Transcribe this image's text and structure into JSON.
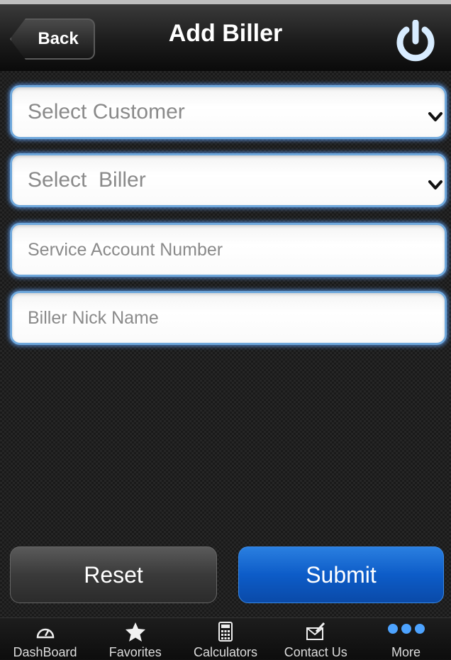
{
  "header": {
    "back_label": "Back",
    "title": "Add Biller",
    "power_icon": "power-icon"
  },
  "form": {
    "customer_select": {
      "value": "Select Customer"
    },
    "biller_select": {
      "value": "Select  Biller"
    },
    "service_account": {
      "placeholder": "Service Account Number"
    },
    "nick_name": {
      "placeholder": "Biller Nick Name"
    }
  },
  "actions": {
    "reset_label": "Reset",
    "submit_label": "Submit"
  },
  "tabbar": {
    "items": [
      {
        "label": "DashBoard",
        "icon": "dashboard-gauge-icon"
      },
      {
        "label": "Favorites",
        "icon": "star-icon"
      },
      {
        "label": "Calculators",
        "icon": "calculator-icon"
      },
      {
        "label": "Contact Us",
        "icon": "envelope-icon"
      },
      {
        "label": "More",
        "icon": "more-dots-icon"
      }
    ]
  },
  "colors": {
    "accent_blue": "#0d5cc8",
    "field_glow": "#6fa8dc",
    "power_icon": "#bfe0ff"
  }
}
